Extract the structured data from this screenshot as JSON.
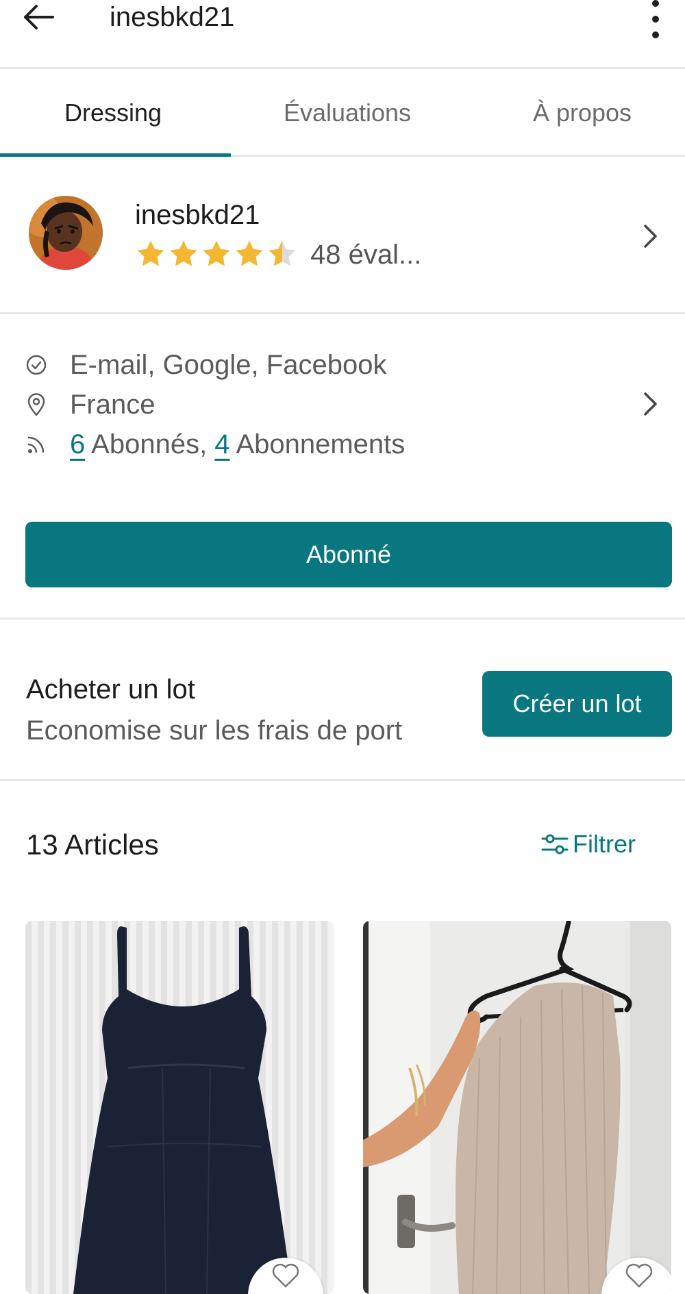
{
  "header": {
    "title": "inesbkd21",
    "back_icon": "arrow-left-icon",
    "menu_icon": "kebab-menu-icon"
  },
  "tabs": [
    {
      "label": "Dressing",
      "active": true
    },
    {
      "label": "Évaluations",
      "active": false
    },
    {
      "label": "À propos",
      "active": false
    }
  ],
  "profile": {
    "username": "inesbkd21",
    "rating_stars": 4.5,
    "rating_count": "48 éval..."
  },
  "info": {
    "verified": "E-mail, Google, Facebook",
    "location": "France",
    "followers_count": "6",
    "followers_text": " Abonnés, ",
    "following_count": "4",
    "following_text": " Abonnements"
  },
  "follow_button": {
    "label": "Abonné"
  },
  "bundle": {
    "title": "Acheter un lot",
    "subtitle": "Economise sur les frais de port",
    "button_label": "Créer un lot"
  },
  "articles": {
    "title": "13 Articles",
    "filter_label": "Filtrer"
  },
  "colors": {
    "accent": "#087780",
    "star": "#f5b731",
    "star_empty": "#dcdcdc"
  }
}
